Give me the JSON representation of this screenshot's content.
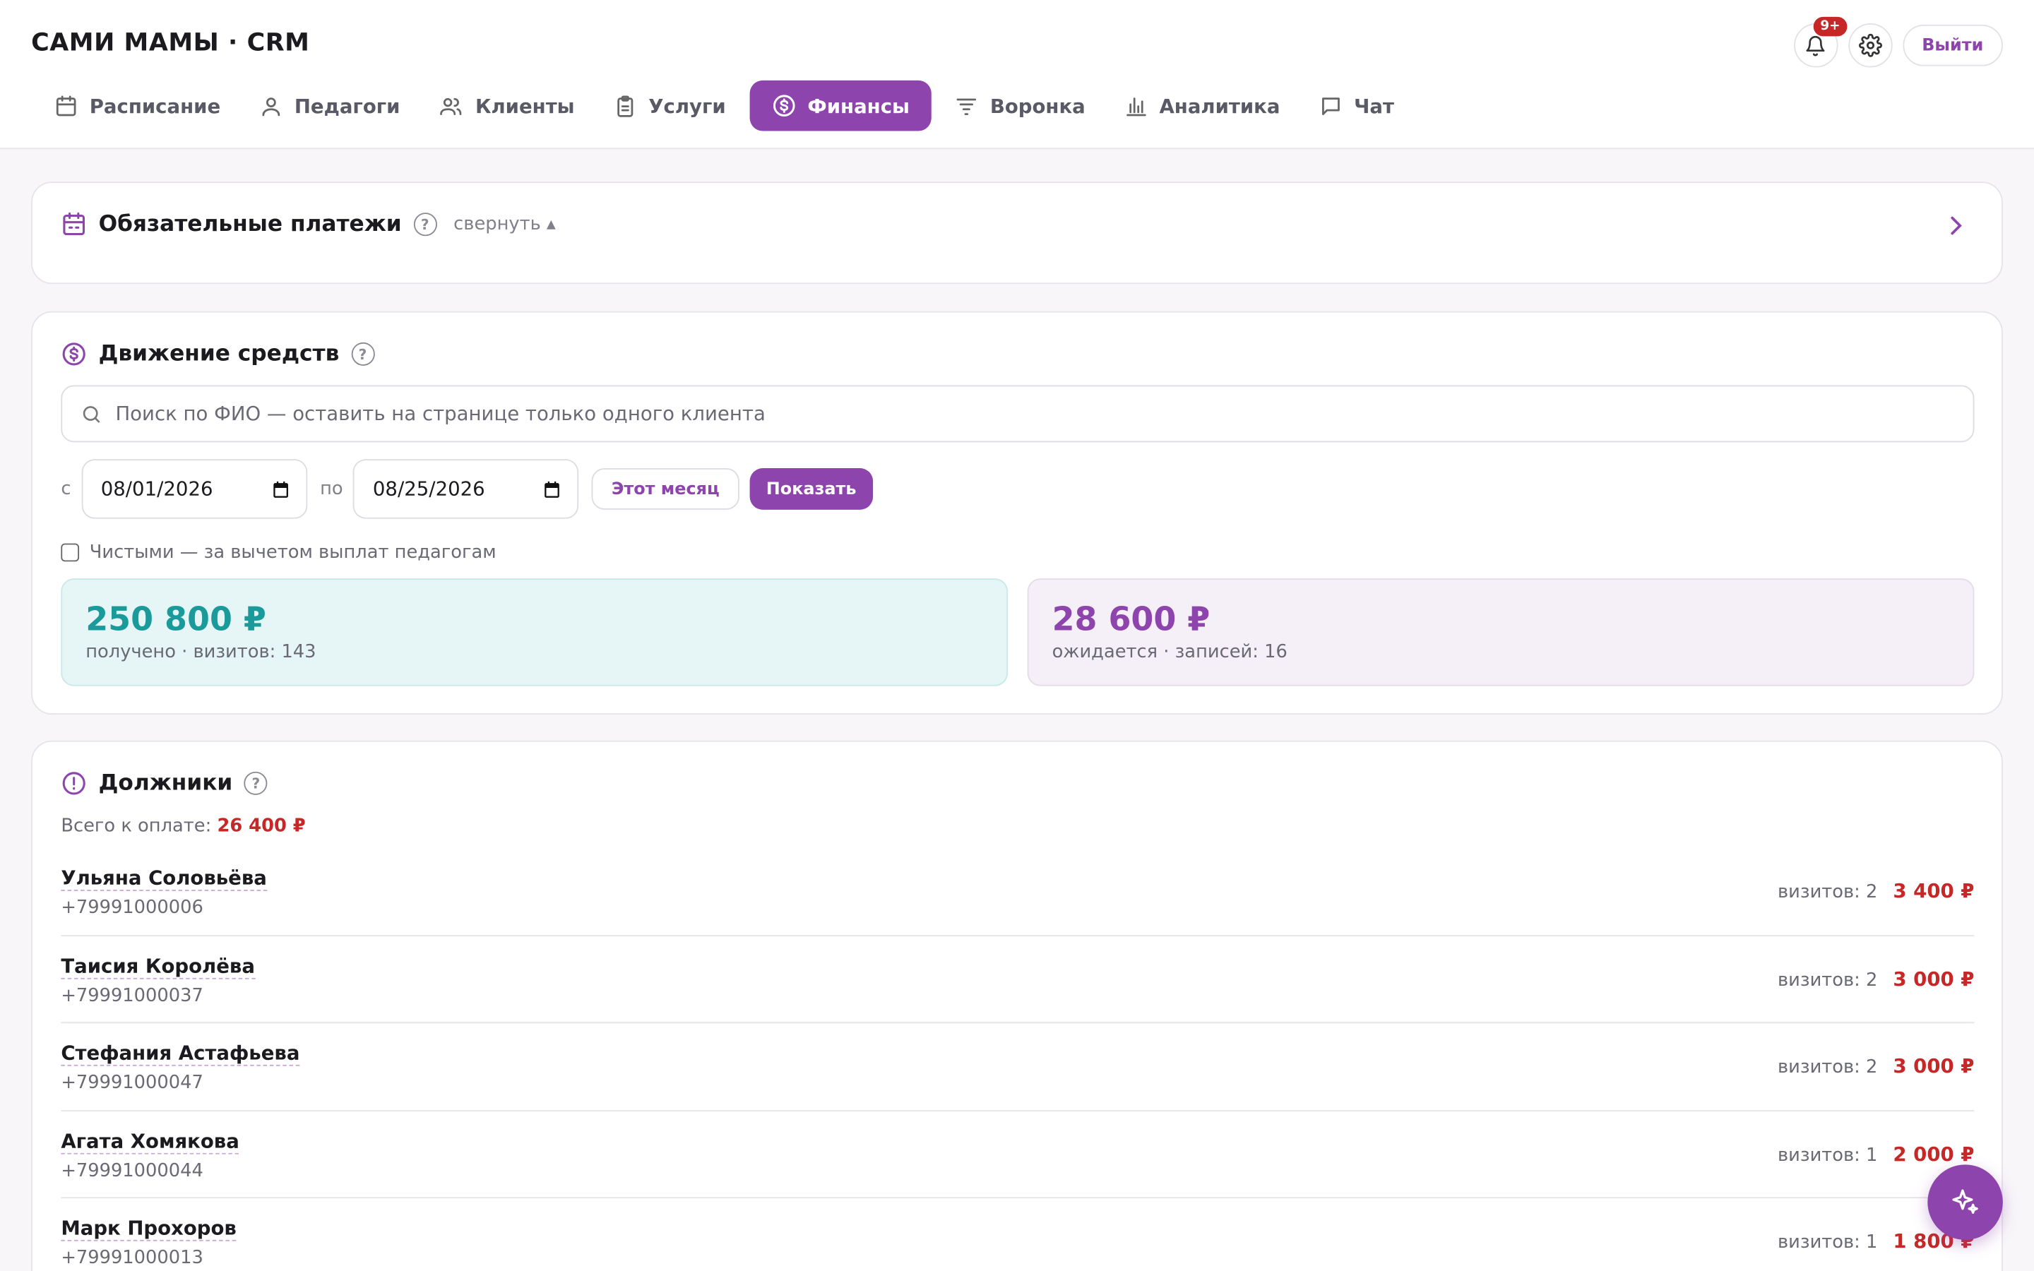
{
  "app": {
    "title": "САМИ МАМЫ · CRM"
  },
  "header": {
    "notifications_badge": "9+",
    "logout_label": "Выйти"
  },
  "nav": {
    "tabs": [
      {
        "label": "Расписание",
        "icon": "calendar-icon",
        "active": false
      },
      {
        "label": "Педагоги",
        "icon": "user-icon",
        "active": false
      },
      {
        "label": "Клиенты",
        "icon": "users-icon",
        "active": false
      },
      {
        "label": "Услуги",
        "icon": "clipboard-icon",
        "active": false
      },
      {
        "label": "Финансы",
        "icon": "dollar-circle-icon",
        "active": true
      },
      {
        "label": "Воронка",
        "icon": "filter-icon",
        "active": false
      },
      {
        "label": "Аналитика",
        "icon": "bar-chart-icon",
        "active": false
      },
      {
        "label": "Чат",
        "icon": "chat-icon",
        "active": false
      }
    ]
  },
  "mandatory_payments": {
    "title": "Обязательные платежи",
    "collapse_label": "свернуть ▴"
  },
  "cash_flow": {
    "title": "Движение средств",
    "search_placeholder": "Поиск по ФИО — оставить на странице только одного клиента",
    "from_label": "с",
    "from_date": "08/01/2026",
    "to_label": "по",
    "to_date": "08/25/2026",
    "this_month_label": "Этот месяц",
    "show_label": "Показать",
    "net_checkbox_label": "Чистыми — за вычетом выплат педагогам",
    "received": {
      "amount": "250 800 ₽",
      "sub": "получено · визитов: 143"
    },
    "expected": {
      "amount": "28 600 ₽",
      "sub": "ожидается · записей: 16"
    }
  },
  "debtors": {
    "title": "Должники",
    "total_label": "Всего к оплате:",
    "total_amount": "26 400 ₽",
    "items": [
      {
        "name": "Ульяна Соловьёва",
        "phone": "+79991000006",
        "visits": "визитов: 2",
        "amount": "3 400 ₽"
      },
      {
        "name": "Таисия Королёва",
        "phone": "+79991000037",
        "visits": "визитов: 2",
        "amount": "3 000 ₽"
      },
      {
        "name": "Стефания Астафьева",
        "phone": "+79991000047",
        "visits": "визитов: 2",
        "amount": "3 000 ₽"
      },
      {
        "name": "Агата Хомякова",
        "phone": "+79991000044",
        "visits": "визитов: 1",
        "amount": "2 000 ₽"
      },
      {
        "name": "Марк Прохоров",
        "phone": "+79991000013",
        "visits": "визитов: 1",
        "amount": "1 800 ₽"
      }
    ]
  },
  "colors": {
    "accent": "#8e44ad",
    "debt": "#c62828",
    "received_bg": "#e6f6f6",
    "received_text": "#1a9a9a",
    "expected_bg": "#f5eff7"
  }
}
